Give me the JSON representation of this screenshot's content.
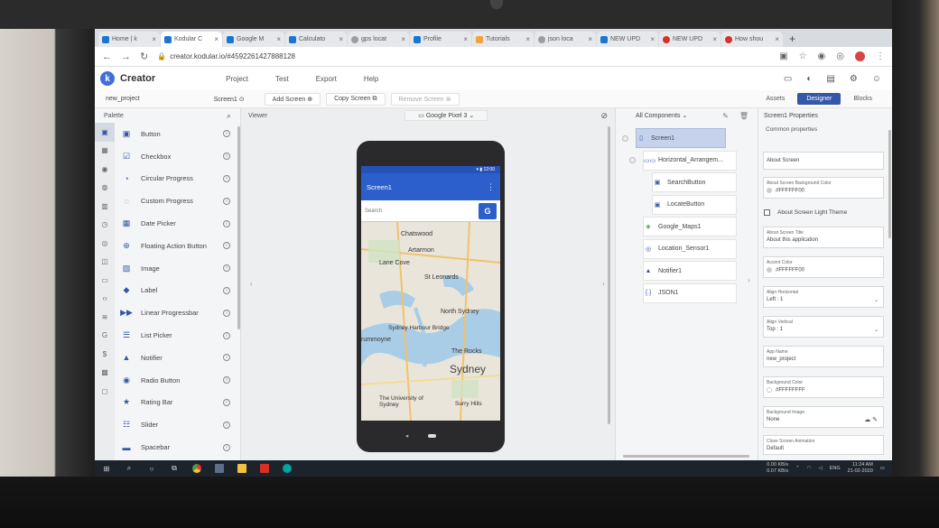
{
  "browser": {
    "tabs": [
      {
        "label": "Home | k"
      },
      {
        "label": "Kodular C"
      },
      {
        "label": "Google M"
      },
      {
        "label": "Calculato"
      },
      {
        "label": "gps locat"
      },
      {
        "label": "Profile"
      },
      {
        "label": "Tutorials"
      },
      {
        "label": "json loca"
      },
      {
        "label": "NEW UPD"
      },
      {
        "label": "NEW UPD"
      },
      {
        "label": "How shou"
      }
    ],
    "new_tab_icon": "+",
    "url": "creator.kodular.io/#4592261427888128"
  },
  "app": {
    "logo_letter": "k",
    "name": "Creator",
    "menu": [
      "Project",
      "Test",
      "Export",
      "Help"
    ]
  },
  "screen_toolbar": {
    "project": "new_project",
    "screen": "Screen1",
    "add_screen": "Add Screen",
    "copy_screen": "Copy Screen",
    "remove_screen": "Remove Screen",
    "views": [
      "Assets",
      "Designer",
      "Blocks"
    ]
  },
  "palette": {
    "title": "Palette",
    "items": [
      {
        "label": "Button",
        "icon": "button-icon"
      },
      {
        "label": "Checkbox",
        "icon": "checkbox-icon"
      },
      {
        "label": "Circular Progress",
        "icon": "circular-progress-icon"
      },
      {
        "label": "Custom Progress",
        "icon": "custom-progress-icon"
      },
      {
        "label": "Date Picker",
        "icon": "date-picker-icon"
      },
      {
        "label": "Floating Action Button",
        "icon": "fab-icon"
      },
      {
        "label": "Image",
        "icon": "image-icon"
      },
      {
        "label": "Label",
        "icon": "label-icon"
      },
      {
        "label": "Linear Progressbar",
        "icon": "linear-progress-icon"
      },
      {
        "label": "List Picker",
        "icon": "list-picker-icon"
      },
      {
        "label": "Notifier",
        "icon": "notifier-icon"
      },
      {
        "label": "Radio Button",
        "icon": "radio-button-icon"
      },
      {
        "label": "Rating Bar",
        "icon": "rating-bar-icon"
      },
      {
        "label": "Slider",
        "icon": "slider-icon"
      },
      {
        "label": "Spacebar",
        "icon": "spacebar-icon"
      }
    ]
  },
  "viewer": {
    "title": "Viewer",
    "device": "Google Pixel 3",
    "phone_time": "12:00",
    "screen_title": "Screen1",
    "search_label": "Search",
    "search_button": "G",
    "map_labels": [
      "Chatswood",
      "Artarmon",
      "Lane Cove",
      "St Leonards",
      "North Sydney",
      "Sydney Harbour Bridge",
      "rummoyne",
      "The Rocks",
      "Sydney",
      "The University of Sydney",
      "Surry Hills"
    ]
  },
  "components": {
    "title": "All Components",
    "nodes": [
      {
        "label": "Screen1",
        "icon": "phone-icon",
        "depth": 0,
        "selected": true
      },
      {
        "label": "Horizontal_Arrangem...",
        "icon": "horizontal-arrangement-icon",
        "depth": 1,
        "selected": false
      },
      {
        "label": "SearchButton",
        "icon": "button-icon",
        "depth": 2,
        "selected": false
      },
      {
        "label": "LocateButton",
        "icon": "button-icon",
        "depth": 2,
        "selected": false
      },
      {
        "label": "Google_Maps1",
        "icon": "maps-icon",
        "depth": 1,
        "selected": false
      },
      {
        "label": "Location_Sensor1",
        "icon": "location-icon",
        "depth": 1,
        "selected": false
      },
      {
        "label": "Notifier1",
        "icon": "bell-icon",
        "depth": 1,
        "selected": false
      },
      {
        "label": "JSON1",
        "icon": "json-icon",
        "depth": 1,
        "selected": false
      }
    ]
  },
  "properties": {
    "title": "Screen1 Properties",
    "section": "Common properties",
    "about_screen": "About Screen",
    "bg_color_caption": "About Screen Background Color",
    "bg_color_value": "#FFFFFF00",
    "light_theme": "About Screen Light Theme",
    "title_caption": "About Screen Title",
    "title_value": "About this application",
    "accent_caption": "Accent Color",
    "accent_value": "#FFFFFF00",
    "align_h_caption": "Align Horizontal",
    "align_h_value": "Left : 1",
    "align_v_caption": "Align Vertical",
    "align_v_value": "Top : 1",
    "app_name_caption": "App Name",
    "app_name_value": "new_project",
    "background_caption": "Background Color",
    "background_value": "#FFFFFFFF",
    "bg_image_caption": "Background Image",
    "bg_image_value": "None",
    "close_anim_caption": "Close Screen Animation",
    "close_anim_value": "Default"
  },
  "taskbar": {
    "network_up": "0.00 KB/s",
    "network_down": "0.07 KB/s",
    "lang": "ENG",
    "time": "11:24 AM",
    "date": "21-02-2020"
  }
}
